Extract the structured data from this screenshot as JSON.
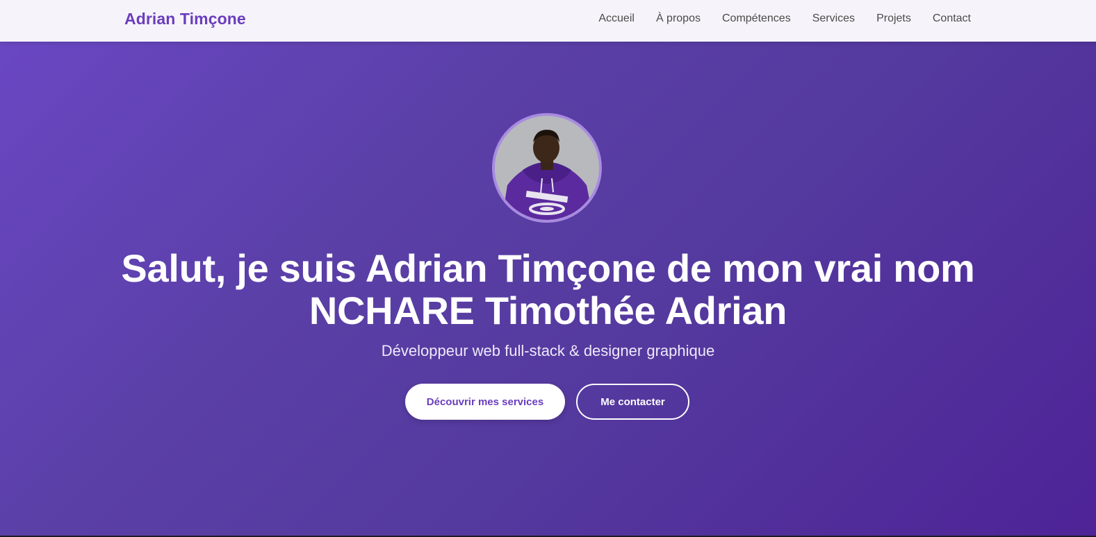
{
  "header": {
    "brand": "Adrian Timçone",
    "nav": [
      {
        "label": "Accueil"
      },
      {
        "label": "À propos"
      },
      {
        "label": "Compétences"
      },
      {
        "label": "Services"
      },
      {
        "label": "Projets"
      },
      {
        "label": "Contact"
      }
    ]
  },
  "hero": {
    "avatar_icon": "profile-photo",
    "title_line1": "Salut, je suis Adrian Timçone de mon vrai nom",
    "title_line2": "NCHARE Timothée Adrian",
    "subtitle": "Développeur web full-stack & designer graphique",
    "primary_button": "Découvrir mes services",
    "secondary_button": "Me contacter"
  },
  "colors": {
    "brand": "#6a3dbd",
    "hero_gradient_start": "#6a47c3",
    "hero_gradient_end": "#4e2397",
    "nav_background": "#f6f4fa"
  }
}
